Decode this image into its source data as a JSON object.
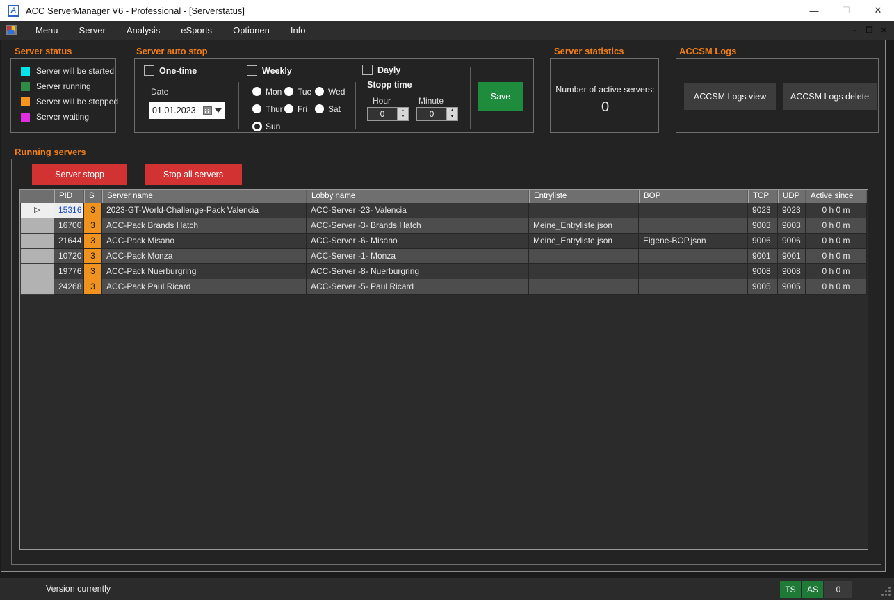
{
  "window": {
    "title": "ACC ServerManager V6 - Professional - [Serverstatus]",
    "icon_letter": "A",
    "controls": {
      "minimize": "—",
      "maximize": "☐",
      "close": "✕"
    }
  },
  "menu": {
    "items": [
      "Menu",
      "Server",
      "Analysis",
      "eSports",
      "Optionen",
      "Info"
    ],
    "mdi_controls": {
      "minimize": "–",
      "restore": "❐",
      "close": "✕"
    }
  },
  "server_status": {
    "title": "Server status",
    "legend": [
      {
        "color": "#00e5e8",
        "label": "Server will be started"
      },
      {
        "color": "#2f8b45",
        "label": "Server running"
      },
      {
        "color": "#f7941d",
        "label": "Server will be stopped"
      },
      {
        "color": "#e12ee1",
        "label": "Server waiting"
      }
    ]
  },
  "auto_stop": {
    "title": "Server auto stop",
    "one_time_label": "One-time",
    "date_label": "Date",
    "date_value": "01.01.2023",
    "weekly_label": "Weekly",
    "days": [
      {
        "label": "Mon",
        "selected": false
      },
      {
        "label": "Tue",
        "selected": false
      },
      {
        "label": "Wed",
        "selected": false
      },
      {
        "label": "Thur",
        "selected": false
      },
      {
        "label": "Fri",
        "selected": false
      },
      {
        "label": "Sat",
        "selected": false
      },
      {
        "label": "Sun",
        "selected": true
      }
    ],
    "dayly_label": "Dayly",
    "stopp_time_label": "Stopp time",
    "hour_label": "Hour",
    "minute_label": "Minute",
    "hour_value": "0",
    "minute_value": "0",
    "save_label": "Save"
  },
  "statistics": {
    "title": "Server statistics",
    "label": "Number of active servers:",
    "value": "0"
  },
  "logs": {
    "title": "ACCSM Logs",
    "view_label": "ACCSM Logs view",
    "delete_label": "ACCSM Logs delete"
  },
  "running": {
    "title": "Running servers",
    "stop_label": "Server stopp",
    "stop_all_label": "Stop all servers",
    "columns": [
      "PID",
      "S",
      "Server name",
      "Lobby name",
      "Entryliste",
      "BOP",
      "TCP",
      "UDP",
      "Active since"
    ],
    "rows": [
      {
        "pid": "15316",
        "s": "3",
        "server": "2023-GT-World-Challenge-Pack Valencia",
        "lobby": "ACC-Server -23- Valencia",
        "entry": "",
        "bop": "",
        "tcp": "9023",
        "udp": "9023",
        "active": "0 h  0 m",
        "selected": true
      },
      {
        "pid": "16700",
        "s": "3",
        "server": "ACC-Pack Brands Hatch",
        "lobby": "ACC-Server -3- Brands Hatch",
        "entry": "Meine_Entryliste.json",
        "bop": "",
        "tcp": "9003",
        "udp": "9003",
        "active": "0 h  0 m",
        "selected": false
      },
      {
        "pid": "21644",
        "s": "3",
        "server": "ACC-Pack Misano",
        "lobby": "ACC-Server -6- Misano",
        "entry": "Meine_Entryliste.json",
        "bop": "Eigene-BOP.json",
        "tcp": "9006",
        "udp": "9006",
        "active": "0 h  0 m",
        "selected": false
      },
      {
        "pid": "10720",
        "s": "3",
        "server": "ACC-Pack Monza",
        "lobby": "ACC-Server -1- Monza",
        "entry": "",
        "bop": "",
        "tcp": "9001",
        "udp": "9001",
        "active": "0 h  0 m",
        "selected": false
      },
      {
        "pid": "19776",
        "s": "3",
        "server": "ACC-Pack Nuerburgring",
        "lobby": "ACC-Server -8- Nuerburgring",
        "entry": "",
        "bop": "",
        "tcp": "9008",
        "udp": "9008",
        "active": "0 h  0 m",
        "selected": false
      },
      {
        "pid": "24268",
        "s": "3",
        "server": "ACC-Pack Paul Ricard",
        "lobby": "ACC-Server -5- Paul Ricard",
        "entry": "",
        "bop": "",
        "tcp": "9005",
        "udp": "9005",
        "active": "0 h  0 m",
        "selected": false
      }
    ]
  },
  "statusbar": {
    "version_label": "Version currently",
    "ts_badge": "TS",
    "as_badge": "AS",
    "count": "0"
  },
  "colors": {
    "accent_orange": "#ef7d1a",
    "button_red": "#d23232",
    "button_green": "#1f8b3d",
    "badge_green": "#1f7a38",
    "s_column_orange": "#f0921e"
  }
}
